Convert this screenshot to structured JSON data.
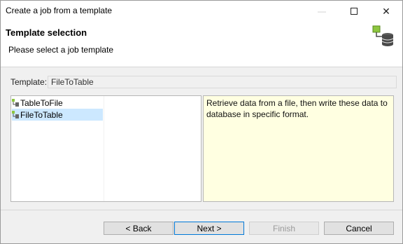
{
  "window": {
    "title": "Create a job from a template"
  },
  "controls": {
    "minimize": "—",
    "close": "✕"
  },
  "banner": {
    "heading": "Template selection",
    "description": "Please select a job template",
    "icon": "job-template-icon"
  },
  "template": {
    "label": "Template:",
    "value": "FileToTable"
  },
  "templates": [
    {
      "label": "TableToFile",
      "icon": "job-icon",
      "selected": false
    },
    {
      "label": "FileToTable",
      "icon": "job-icon",
      "selected": true
    }
  ],
  "description_panel": {
    "text": "Retrieve data from a file, then write these data to database in specific format."
  },
  "buttons": {
    "back": "< Back",
    "next": "Next >",
    "finish": "Finish",
    "cancel": "Cancel"
  },
  "colors": {
    "selection": "#cce8ff",
    "description_bg": "#ffffe1",
    "icon_green": "#8dc63f",
    "icon_db": "#4a4a4a"
  }
}
